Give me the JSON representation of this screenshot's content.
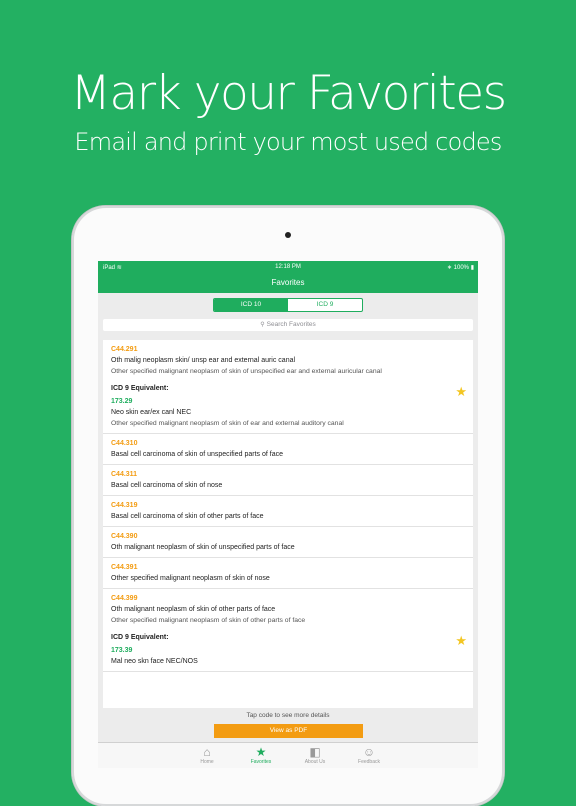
{
  "promo": {
    "headline": "Mark your Favorites",
    "subline": "Email and print your most used codes"
  },
  "status_bar": {
    "device": "iPad",
    "wifi_icon": "wifi-icon",
    "time": "12:18 PM",
    "battery": "100%"
  },
  "nav": {
    "title": "Favorites"
  },
  "segment": {
    "options": [
      "ICD 10",
      "ICD 9"
    ],
    "selected": "ICD 10"
  },
  "search": {
    "placeholder": "Search Favorites"
  },
  "favorites": [
    {
      "code": "C44.291",
      "short": "Oth malig neoplasm skin/ unsp ear and external auric canal",
      "long": "Other specified malignant neoplasm of skin of unspecified ear and external auricular canal",
      "equivalent": {
        "title": "ICD 9 Equivalent:",
        "code": "173.29",
        "short": "Neo skin ear/ex canl NEC",
        "long": "Other specified malignant neoplasm of skin of ear and external auditory canal"
      }
    },
    {
      "code": "C44.310",
      "short": "Basal cell carcinoma of skin of unspecified parts of face"
    },
    {
      "code": "C44.311",
      "short": "Basal cell carcinoma of skin of nose"
    },
    {
      "code": "C44.319",
      "short": "Basal cell carcinoma of skin of other parts of face"
    },
    {
      "code": "C44.390",
      "short": "Oth malignant neoplasm of skin of unspecified parts of face"
    },
    {
      "code": "C44.391",
      "short": "Other specified malignant neoplasm of skin of nose"
    },
    {
      "code": "C44.399",
      "short": "Oth malignant neoplasm of skin of other parts of face",
      "long": "Other specified malignant neoplasm of skin of other parts of face",
      "equivalent": {
        "title": "ICD 9 Equivalent:",
        "code": "173.39",
        "short": "Mal neo skn face NEC/NOS"
      }
    }
  ],
  "footer": {
    "hint": "Tap code to see more details",
    "pdf_button": "View as PDF"
  },
  "tabs": [
    {
      "label": "Home",
      "icon": "house-icon"
    },
    {
      "label": "Favorites",
      "icon": "star-icon",
      "active": true
    },
    {
      "label": "About Us",
      "icon": "info-icon"
    },
    {
      "label": "Feedback",
      "icon": "speech-bubble-icon"
    }
  ],
  "colors": {
    "background": "#23b062",
    "brand": "#1fad5e",
    "code": "#f39c12",
    "star": "#f3c622"
  }
}
